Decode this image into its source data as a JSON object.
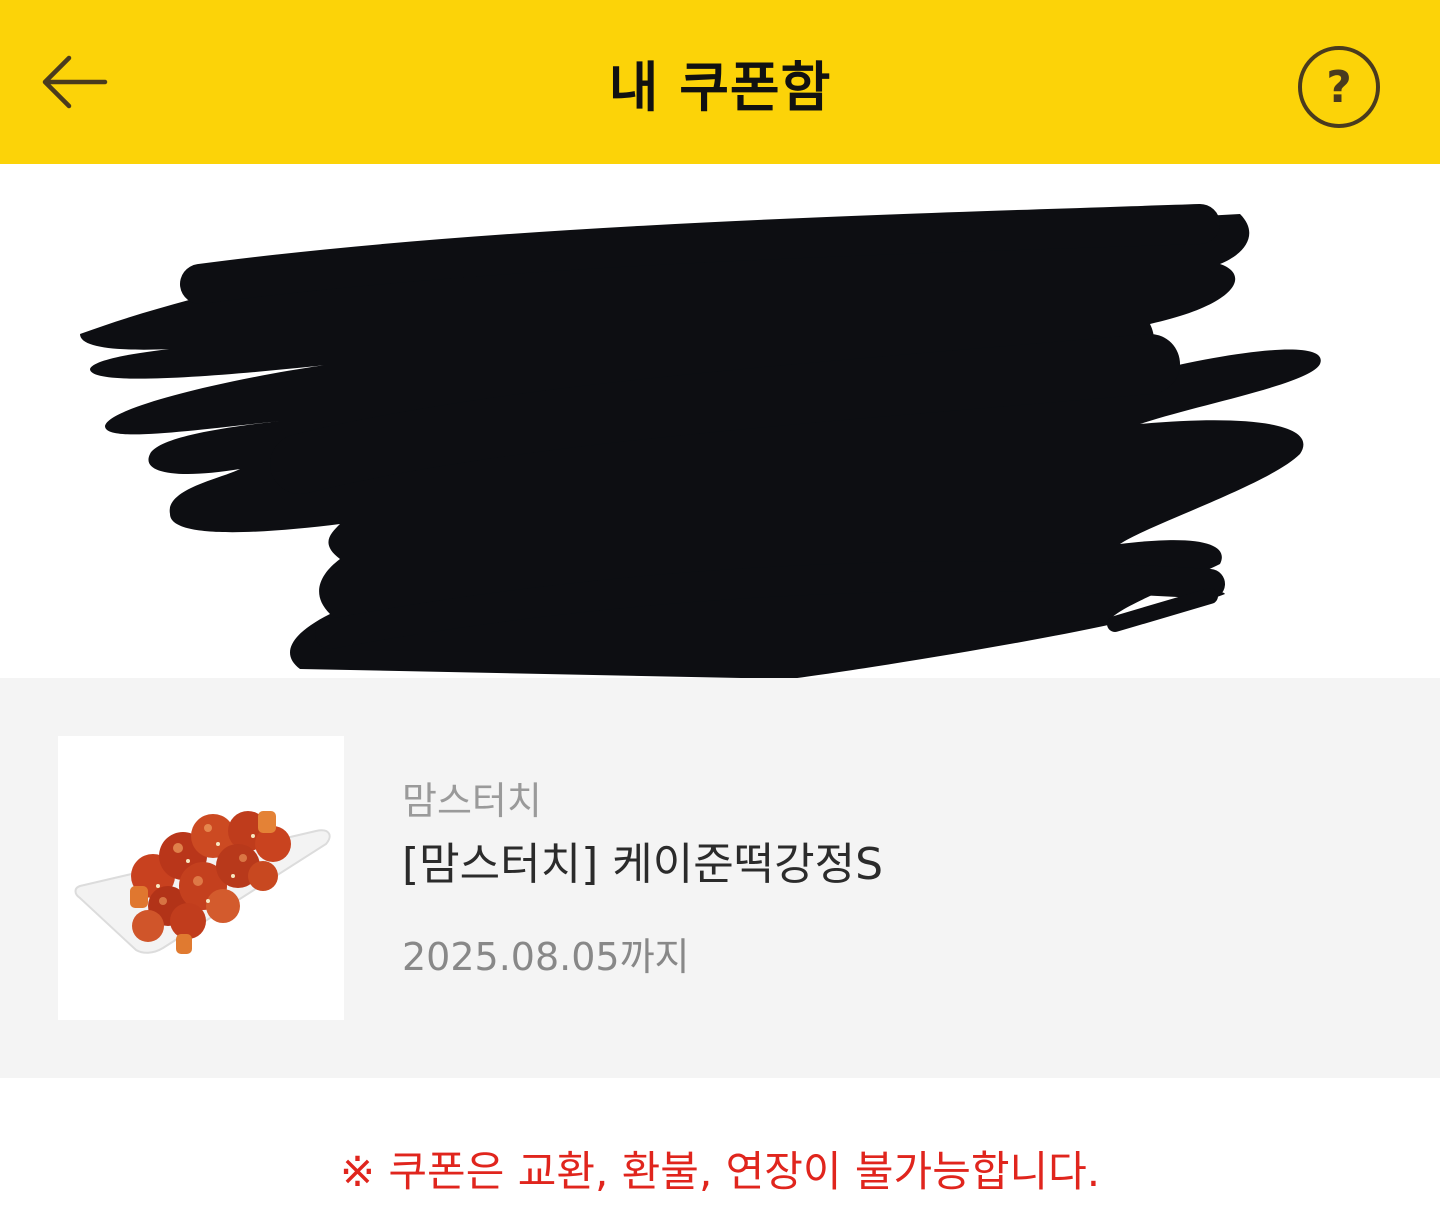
{
  "header": {
    "title": "내 쿠폰함",
    "back_icon": "arrow-left-icon",
    "help_icon": "question-circle-icon",
    "help_symbol": "?",
    "background_color": "#FCD308"
  },
  "barcode": {
    "redacted": true
  },
  "coupon": {
    "brand": "맘스터치",
    "product_name": "[맘스터치] 케이준떡강정S",
    "expiry": "2025.08.05까지",
    "image_icon": "fried-chicken-icon"
  },
  "notice": {
    "text": "※ 쿠폰은 교환, 환불, 연장이 불가능합니다.",
    "color": "#E0251D"
  }
}
